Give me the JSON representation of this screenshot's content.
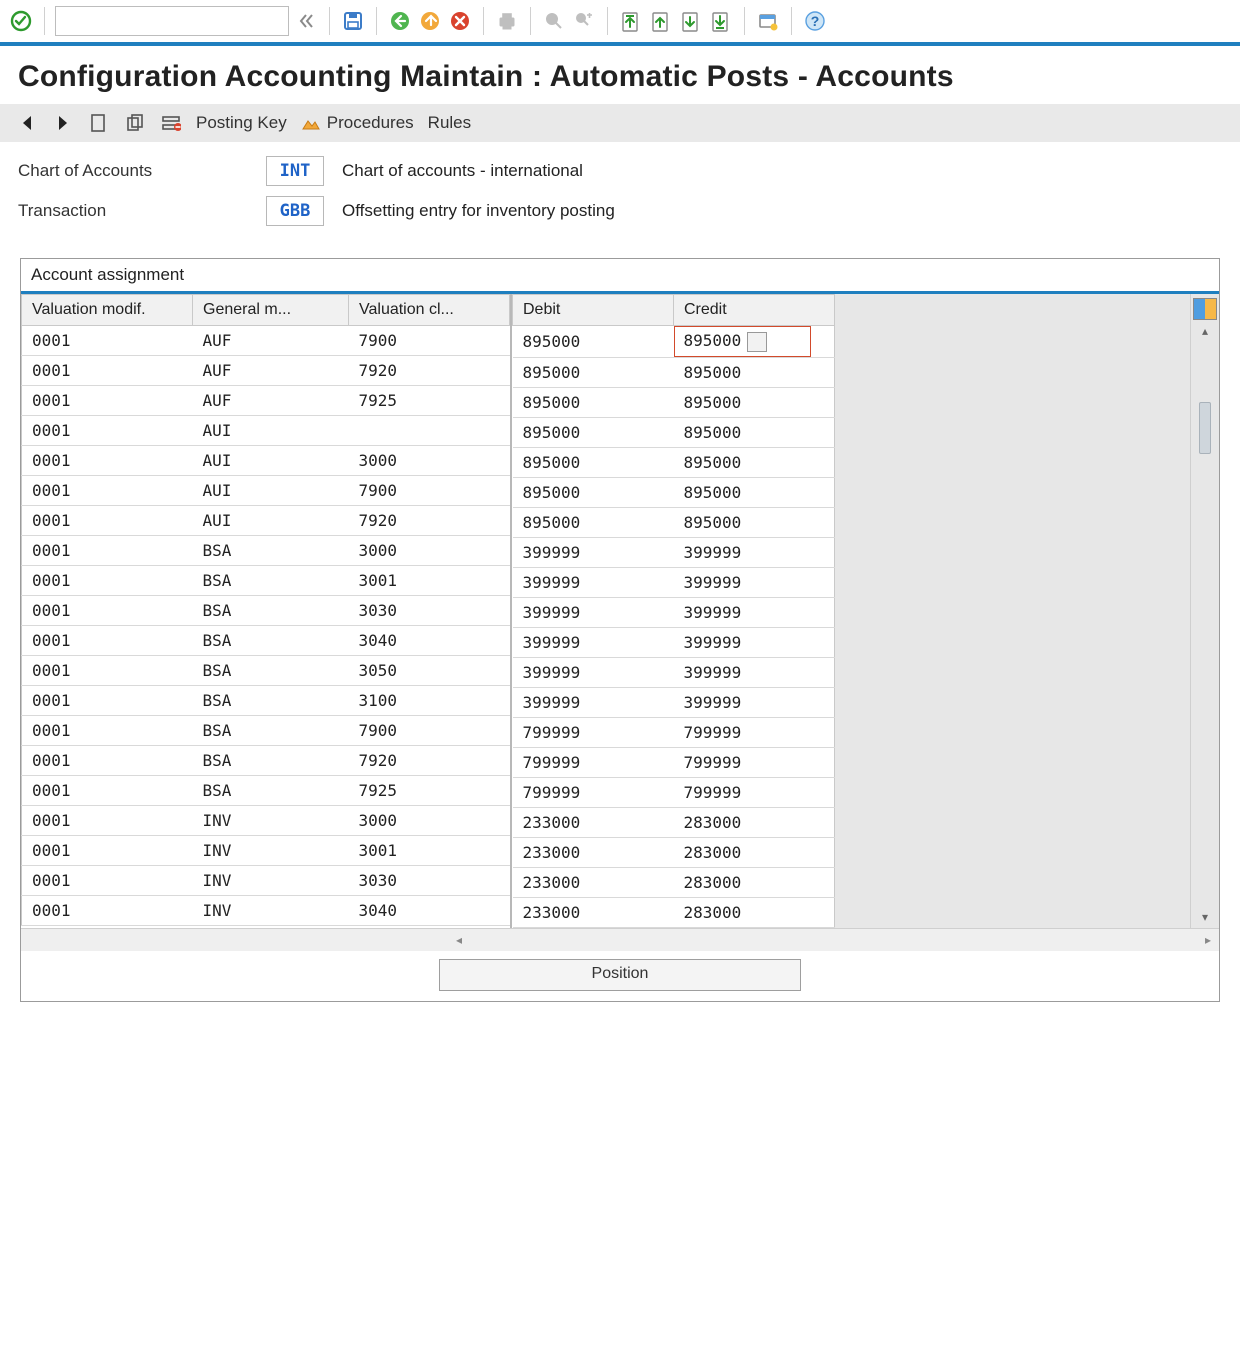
{
  "title": "Configuration Accounting Maintain : Automatic Posts - Accounts",
  "apptoolbar": {
    "posting_key": "Posting Key",
    "procedures": "Procedures",
    "rules": "Rules"
  },
  "params": {
    "coa_label": "Chart of Accounts",
    "coa_code": "INT",
    "coa_text": "Chart of accounts - international",
    "trx_label": "Transaction",
    "trx_code": "GBB",
    "trx_text": "Offsetting entry for inventory posting"
  },
  "table": {
    "caption": "Account assignment",
    "cols": {
      "vm": "Valuation modif.",
      "gm": "General m...",
      "vc": "Valuation cl...",
      "db": "Debit",
      "cr": "Credit"
    },
    "rows": [
      {
        "vm": "0001",
        "gm": "AUF",
        "vc": "7900",
        "db": "895000",
        "cr": "895000"
      },
      {
        "vm": "0001",
        "gm": "AUF",
        "vc": "7920",
        "db": "895000",
        "cr": "895000"
      },
      {
        "vm": "0001",
        "gm": "AUF",
        "vc": "7925",
        "db": "895000",
        "cr": "895000"
      },
      {
        "vm": "0001",
        "gm": "AUI",
        "vc": "",
        "db": "895000",
        "cr": "895000"
      },
      {
        "vm": "0001",
        "gm": "AUI",
        "vc": "3000",
        "db": "895000",
        "cr": "895000"
      },
      {
        "vm": "0001",
        "gm": "AUI",
        "vc": "7900",
        "db": "895000",
        "cr": "895000"
      },
      {
        "vm": "0001",
        "gm": "AUI",
        "vc": "7920",
        "db": "895000",
        "cr": "895000"
      },
      {
        "vm": "0001",
        "gm": "BSA",
        "vc": "3000",
        "db": "399999",
        "cr": "399999"
      },
      {
        "vm": "0001",
        "gm": "BSA",
        "vc": "3001",
        "db": "399999",
        "cr": "399999"
      },
      {
        "vm": "0001",
        "gm": "BSA",
        "vc": "3030",
        "db": "399999",
        "cr": "399999"
      },
      {
        "vm": "0001",
        "gm": "BSA",
        "vc": "3040",
        "db": "399999",
        "cr": "399999"
      },
      {
        "vm": "0001",
        "gm": "BSA",
        "vc": "3050",
        "db": "399999",
        "cr": "399999"
      },
      {
        "vm": "0001",
        "gm": "BSA",
        "vc": "3100",
        "db": "399999",
        "cr": "399999"
      },
      {
        "vm": "0001",
        "gm": "BSA",
        "vc": "7900",
        "db": "799999",
        "cr": "799999"
      },
      {
        "vm": "0001",
        "gm": "BSA",
        "vc": "7920",
        "db": "799999",
        "cr": "799999"
      },
      {
        "vm": "0001",
        "gm": "BSA",
        "vc": "7925",
        "db": "799999",
        "cr": "799999"
      },
      {
        "vm": "0001",
        "gm": "INV",
        "vc": "3000",
        "db": "233000",
        "cr": "283000"
      },
      {
        "vm": "0001",
        "gm": "INV",
        "vc": "3001",
        "db": "233000",
        "cr": "283000"
      },
      {
        "vm": "0001",
        "gm": "INV",
        "vc": "3030",
        "db": "233000",
        "cr": "283000"
      },
      {
        "vm": "0001",
        "gm": "INV",
        "vc": "3040",
        "db": "233000",
        "cr": "283000"
      }
    ],
    "position_btn": "Position"
  },
  "icons": {
    "enter": "enter-icon",
    "save": "save-icon",
    "back": "back-icon",
    "exit": "exit-icon",
    "cancel": "cancel-icon",
    "print": "print-icon",
    "find": "find-icon",
    "findnext": "find-next-icon",
    "firstpage": "first-page-icon",
    "prevpage": "prev-page-icon",
    "nextpage": "next-page-icon",
    "lastpage": "last-page-icon",
    "newsession": "new-session-icon",
    "help": "help-icon"
  }
}
